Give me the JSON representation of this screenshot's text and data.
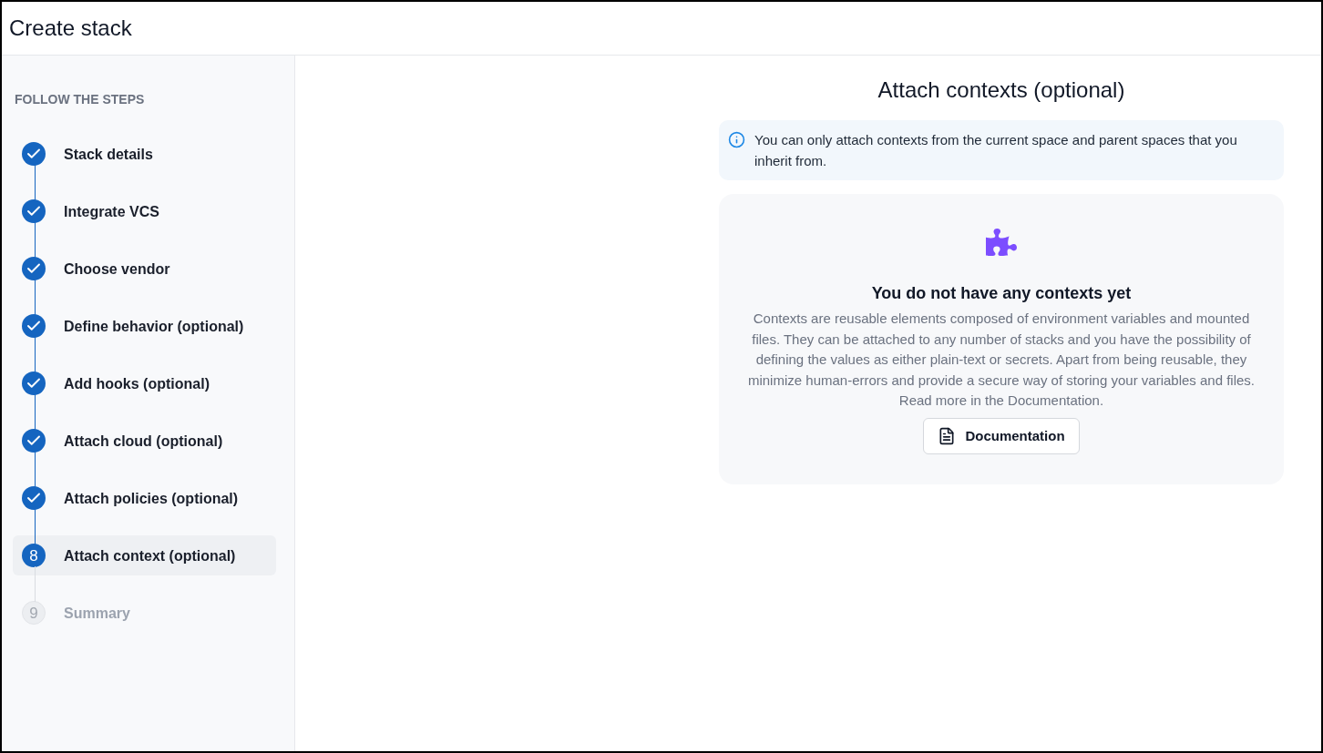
{
  "window": {
    "title": "Create stack"
  },
  "sidebar": {
    "heading": "FOLLOW THE STEPS",
    "steps": [
      {
        "label": "Stack details",
        "kind": "done"
      },
      {
        "label": "Integrate VCS",
        "kind": "done"
      },
      {
        "label": "Choose vendor",
        "kind": "done"
      },
      {
        "label": "Define behavior (optional)",
        "kind": "done"
      },
      {
        "label": "Add hooks (optional)",
        "kind": "done"
      },
      {
        "label": "Attach cloud (optional)",
        "kind": "done"
      },
      {
        "label": "Attach policies (optional)",
        "kind": "done"
      },
      {
        "label": "Attach context (optional)",
        "kind": "current",
        "number": "8"
      },
      {
        "label": "Summary",
        "kind": "pending",
        "number": "9"
      }
    ]
  },
  "main": {
    "title": "Attach contexts (optional)",
    "notice": "You can only attach contexts from the current space and parent spaces that you inherit from.",
    "empty_state": {
      "title": "You do not have any contexts yet",
      "description": "Contexts are reusable elements composed of environment variables and mounted files. They can be attached to any number of stacks and you have the possibility of defining the values as either plain-text or secrets. Apart from being reusable, they minimize human-errors and provide a secure way of storing your variables and files.",
      "read_more": "Read more in the Documentation.",
      "button": "Documentation"
    }
  }
}
